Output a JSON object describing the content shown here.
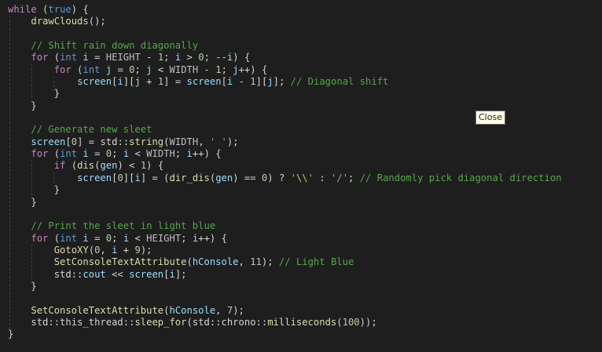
{
  "tooltip": {
    "label": "Close"
  },
  "colors": {
    "background": "#1e1e1e",
    "keyword": "#569cd6",
    "control": "#c586c0",
    "function": "#dcdcaa",
    "variable": "#9cdcfe",
    "type": "#4ec9b0",
    "number": "#b5cea8",
    "string": "#ce9178",
    "comment": "#57a64a"
  },
  "code": [
    [
      [
        "ctl",
        "while"
      ],
      [
        "op",
        " ("
      ],
      [
        "kw",
        "true"
      ],
      [
        "op",
        ") {"
      ]
    ],
    [
      [
        "op",
        "    "
      ],
      [
        "fn",
        "drawClouds"
      ],
      [
        "op",
        "();"
      ]
    ],
    [],
    [
      [
        "op",
        "    "
      ],
      [
        "cm",
        "// Shift rain down diagonally"
      ]
    ],
    [
      [
        "op",
        "    "
      ],
      [
        "ctl",
        "for"
      ],
      [
        "op",
        " ("
      ],
      [
        "kw",
        "int"
      ],
      [
        "op",
        " "
      ],
      [
        "var",
        "i"
      ],
      [
        "op",
        " = "
      ],
      [
        "mac",
        "HEIGHT"
      ],
      [
        "op",
        " - "
      ],
      [
        "num",
        "1"
      ],
      [
        "op",
        "; "
      ],
      [
        "var",
        "i"
      ],
      [
        "op",
        " > "
      ],
      [
        "num",
        "0"
      ],
      [
        "op",
        "; --"
      ],
      [
        "var",
        "i"
      ],
      [
        "op",
        ") {"
      ]
    ],
    [
      [
        "op",
        "        "
      ],
      [
        "ctl",
        "for"
      ],
      [
        "op",
        " ("
      ],
      [
        "kw",
        "int"
      ],
      [
        "op",
        " "
      ],
      [
        "var",
        "j"
      ],
      [
        "op",
        " = "
      ],
      [
        "num",
        "0"
      ],
      [
        "op",
        "; "
      ],
      [
        "var",
        "j"
      ],
      [
        "op",
        " < "
      ],
      [
        "mac",
        "WIDTH"
      ],
      [
        "op",
        " - "
      ],
      [
        "num",
        "1"
      ],
      [
        "op",
        "; "
      ],
      [
        "var",
        "j"
      ],
      [
        "op",
        "++) {"
      ]
    ],
    [
      [
        "op",
        "            "
      ],
      [
        "var",
        "screen"
      ],
      [
        "op",
        "["
      ],
      [
        "var",
        "i"
      ],
      [
        "op",
        "]["
      ],
      [
        "var",
        "j"
      ],
      [
        "op",
        " + "
      ],
      [
        "num",
        "1"
      ],
      [
        "op",
        "] = "
      ],
      [
        "var",
        "screen"
      ],
      [
        "op",
        "["
      ],
      [
        "var",
        "i"
      ],
      [
        "op",
        " - "
      ],
      [
        "num",
        "1"
      ],
      [
        "op",
        "]["
      ],
      [
        "var",
        "j"
      ],
      [
        "op",
        "]; "
      ],
      [
        "cm",
        "// Diagonal shift"
      ]
    ],
    [
      [
        "op",
        "        }"
      ]
    ],
    [
      [
        "op",
        "    }"
      ]
    ],
    [],
    [
      [
        "op",
        "    "
      ],
      [
        "cm",
        "// Generate new sleet"
      ]
    ],
    [
      [
        "op",
        "    "
      ],
      [
        "var",
        "screen"
      ],
      [
        "op",
        "["
      ],
      [
        "num",
        "0"
      ],
      [
        "op",
        "] = "
      ],
      [
        "op",
        "std::"
      ],
      [
        "fn",
        "string"
      ],
      [
        "op",
        "("
      ],
      [
        "mac",
        "WIDTH"
      ],
      [
        "op",
        ", "
      ],
      [
        "str",
        "' '"
      ],
      [
        "op",
        ");"
      ]
    ],
    [
      [
        "op",
        "    "
      ],
      [
        "ctl",
        "for"
      ],
      [
        "op",
        " ("
      ],
      [
        "kw",
        "int"
      ],
      [
        "op",
        " "
      ],
      [
        "var",
        "i"
      ],
      [
        "op",
        " = "
      ],
      [
        "num",
        "0"
      ],
      [
        "op",
        "; "
      ],
      [
        "var",
        "i"
      ],
      [
        "op",
        " < "
      ],
      [
        "mac",
        "WIDTH"
      ],
      [
        "op",
        "; "
      ],
      [
        "var",
        "i"
      ],
      [
        "op",
        "++) {"
      ]
    ],
    [
      [
        "op",
        "        "
      ],
      [
        "ctl",
        "if"
      ],
      [
        "op",
        " ("
      ],
      [
        "fn",
        "dis"
      ],
      [
        "op",
        "("
      ],
      [
        "var",
        "gen"
      ],
      [
        "op",
        ") < "
      ],
      [
        "num",
        "1"
      ],
      [
        "op",
        ") {"
      ]
    ],
    [
      [
        "op",
        "            "
      ],
      [
        "var",
        "screen"
      ],
      [
        "op",
        "["
      ],
      [
        "num",
        "0"
      ],
      [
        "op",
        "]["
      ],
      [
        "var",
        "i"
      ],
      [
        "op",
        "] = ("
      ],
      [
        "fn",
        "dir_dis"
      ],
      [
        "op",
        "("
      ],
      [
        "var",
        "gen"
      ],
      [
        "op",
        ") == "
      ],
      [
        "num",
        "0"
      ],
      [
        "op",
        ") ? "
      ],
      [
        "str",
        "'"
      ],
      [
        "esc",
        "\\\\"
      ],
      [
        "str",
        "'"
      ],
      [
        "op",
        " : "
      ],
      [
        "str",
        "'/'"
      ],
      [
        "op",
        "; "
      ],
      [
        "cm",
        "// Randomly pick diagonal direction"
      ]
    ],
    [
      [
        "op",
        "        }"
      ]
    ],
    [
      [
        "op",
        "    }"
      ]
    ],
    [],
    [
      [
        "op",
        "    "
      ],
      [
        "cm",
        "// Print the sleet in light blue"
      ]
    ],
    [
      [
        "op",
        "    "
      ],
      [
        "ctl",
        "for"
      ],
      [
        "op",
        " ("
      ],
      [
        "kw",
        "int"
      ],
      [
        "op",
        " "
      ],
      [
        "var",
        "i"
      ],
      [
        "op",
        " = "
      ],
      [
        "num",
        "0"
      ],
      [
        "op",
        "; "
      ],
      [
        "var",
        "i"
      ],
      [
        "op",
        " < "
      ],
      [
        "mac",
        "HEIGHT"
      ],
      [
        "op",
        "; "
      ],
      [
        "var",
        "i"
      ],
      [
        "op",
        "++) {"
      ]
    ],
    [
      [
        "op",
        "        "
      ],
      [
        "fn",
        "GotoXY"
      ],
      [
        "op",
        "("
      ],
      [
        "num",
        "0"
      ],
      [
        "op",
        ", "
      ],
      [
        "var",
        "i"
      ],
      [
        "op",
        " + "
      ],
      [
        "num",
        "9"
      ],
      [
        "op",
        ");"
      ]
    ],
    [
      [
        "op",
        "        "
      ],
      [
        "fn",
        "SetConsoleTextAttribute"
      ],
      [
        "op",
        "("
      ],
      [
        "var",
        "hConsole"
      ],
      [
        "op",
        ", "
      ],
      [
        "num",
        "11"
      ],
      [
        "op",
        "); "
      ],
      [
        "cm",
        "// Light Blue"
      ]
    ],
    [
      [
        "op",
        "        "
      ],
      [
        "op",
        "std::"
      ],
      [
        "var",
        "cout"
      ],
      [
        "op",
        " << "
      ],
      [
        "var",
        "screen"
      ],
      [
        "op",
        "["
      ],
      [
        "var",
        "i"
      ],
      [
        "op",
        "];"
      ]
    ],
    [
      [
        "op",
        "    }"
      ]
    ],
    [],
    [
      [
        "op",
        "    "
      ],
      [
        "fn",
        "SetConsoleTextAttribute"
      ],
      [
        "op",
        "("
      ],
      [
        "var",
        "hConsole"
      ],
      [
        "op",
        ", "
      ],
      [
        "num",
        "7"
      ],
      [
        "op",
        ");"
      ]
    ],
    [
      [
        "op",
        "    "
      ],
      [
        "op",
        "std::this_thread::"
      ],
      [
        "fn",
        "sleep_for"
      ],
      [
        "op",
        "(std::chrono::"
      ],
      [
        "fn",
        "milliseconds"
      ],
      [
        "op",
        "("
      ],
      [
        "num",
        "100"
      ],
      [
        "op",
        "));"
      ]
    ],
    [
      [
        "op",
        "}"
      ]
    ]
  ]
}
